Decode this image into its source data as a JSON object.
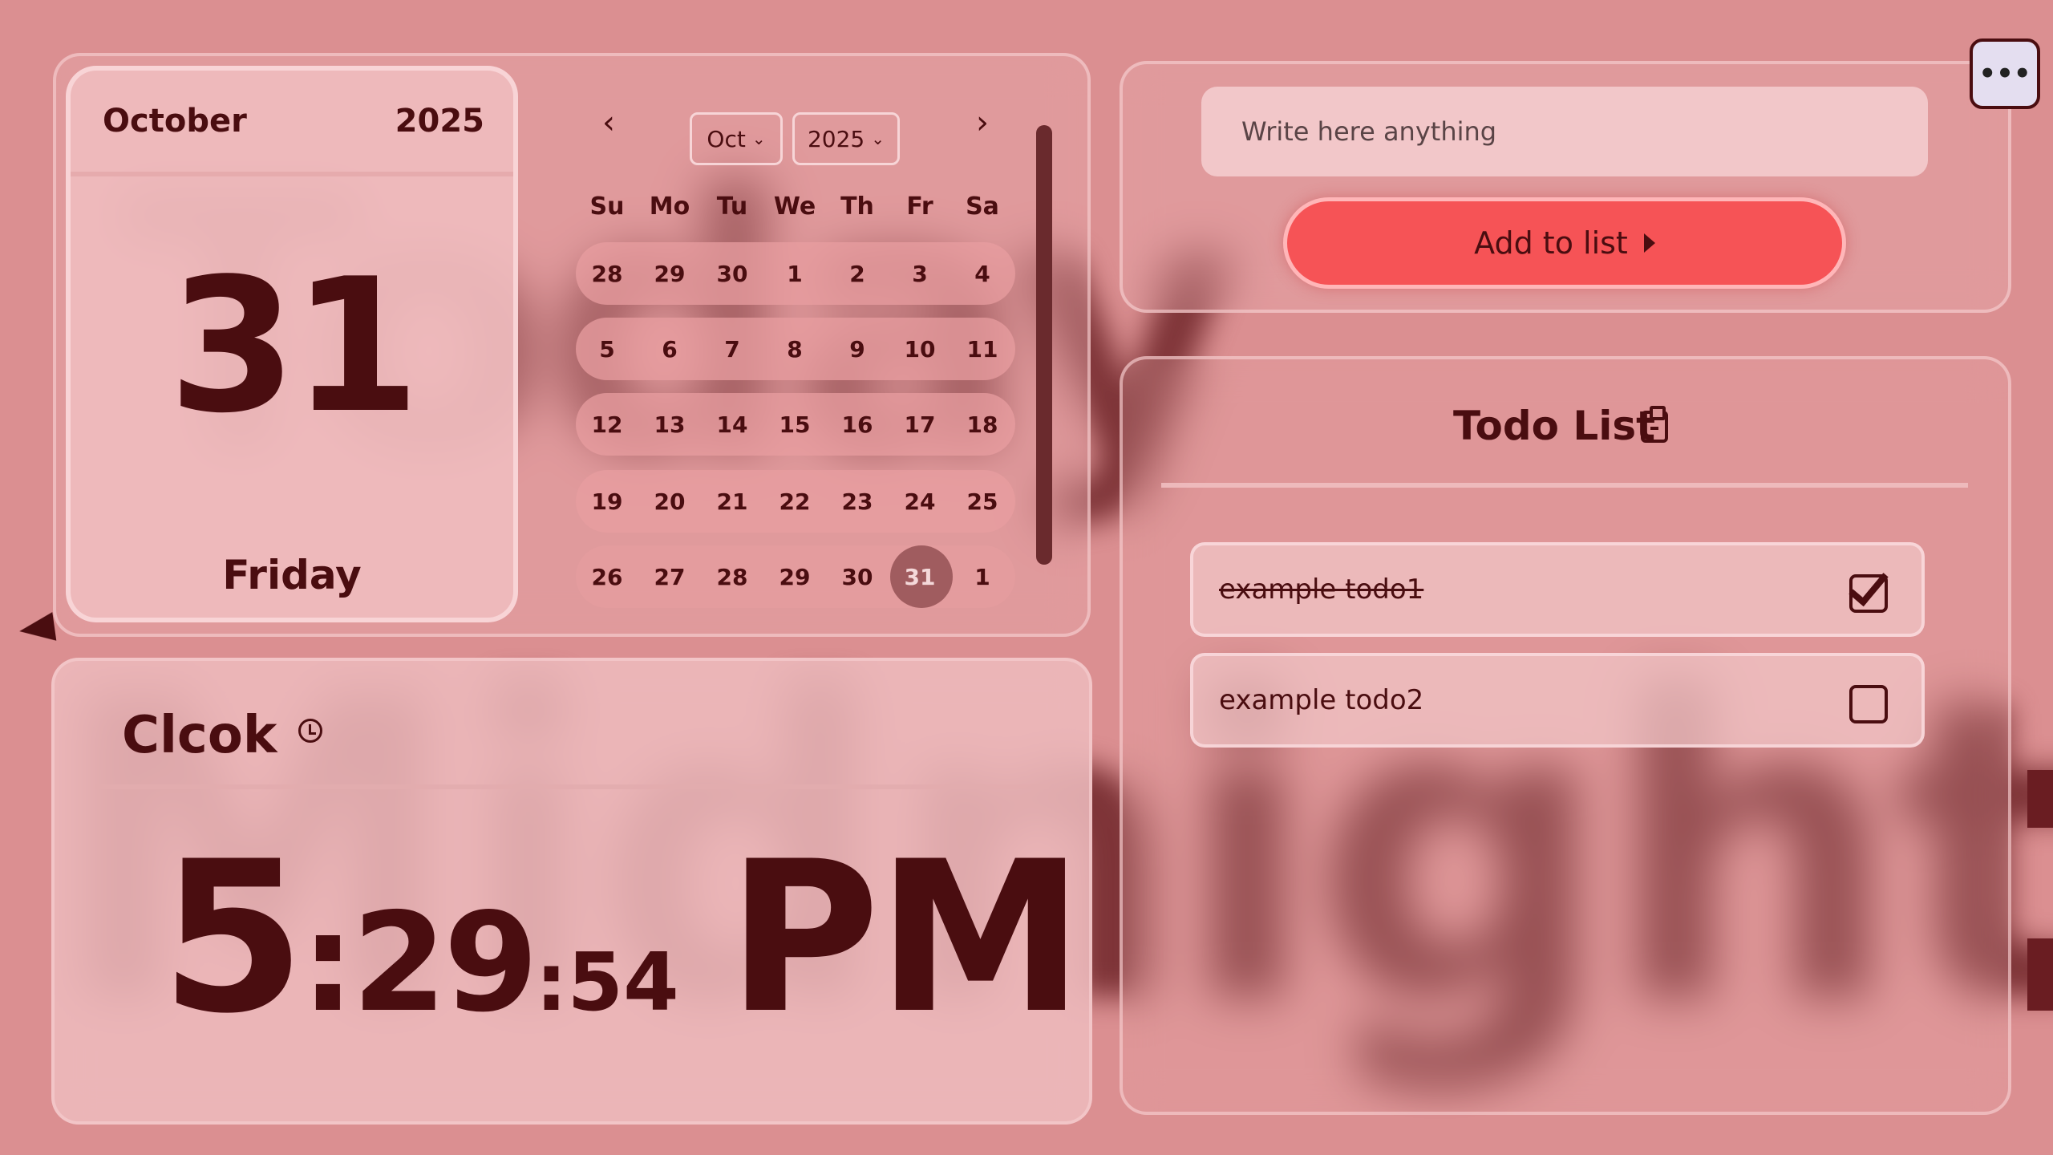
{
  "background_words": [
    "Today",
    "Midnight"
  ],
  "colors": {
    "accent": "#f65356",
    "text": "#4a0d10",
    "background": "#db8f91"
  },
  "date_card": {
    "month": "October",
    "year": "2025",
    "day": "31",
    "weekday": "Friday"
  },
  "calendar": {
    "prev_icon": "chevron-left-icon",
    "next_icon": "chevron-right-icon",
    "prev_label": "‹",
    "next_label": "›",
    "month_select": "Oct",
    "year_select": "2025",
    "weekdays": [
      "Su",
      "Mo",
      "Tu",
      "We",
      "Th",
      "Fr",
      "Sa"
    ],
    "weeks": [
      [
        "28",
        "29",
        "30",
        "1",
        "2",
        "3",
        "4"
      ],
      [
        "5",
        "6",
        "7",
        "8",
        "9",
        "10",
        "11"
      ],
      [
        "12",
        "13",
        "14",
        "15",
        "16",
        "17",
        "18"
      ],
      [
        "19",
        "20",
        "21",
        "22",
        "23",
        "24",
        "25"
      ],
      [
        "26",
        "27",
        "28",
        "29",
        "30",
        "31",
        "1"
      ]
    ],
    "selected": "31"
  },
  "input": {
    "placeholder": "Write here anything",
    "add_button": "Add to list"
  },
  "menu": {
    "more_label": "•••"
  },
  "todo": {
    "title": "Todo List",
    "items": [
      {
        "text": "example todo1",
        "done": true
      },
      {
        "text": "example todo2",
        "done": false
      }
    ]
  },
  "clock": {
    "title": "Clcok",
    "hours": "5",
    "minutes": "29",
    "seconds": "54",
    "ampm": "PM"
  }
}
